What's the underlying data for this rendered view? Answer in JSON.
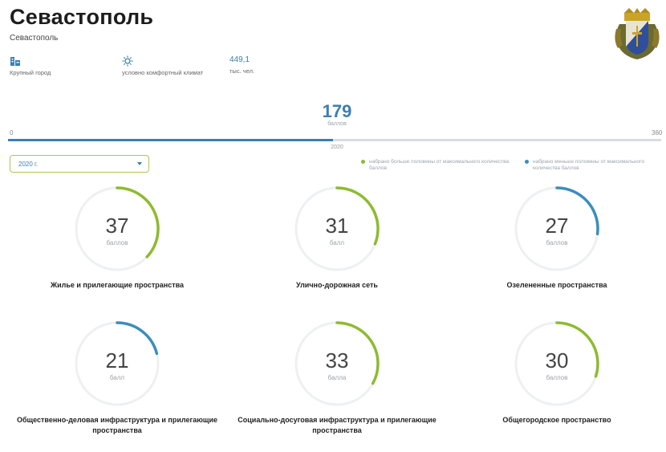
{
  "header": {
    "title": "Севастополь",
    "subtitle": "Севастополь"
  },
  "info": [
    {
      "icon": "city-buildings-icon",
      "label": "Крупный город"
    },
    {
      "icon": "sun-climate-icon",
      "label": "условно комфортный климат"
    },
    {
      "value": "449,1",
      "label": "тыс. чел."
    }
  ],
  "total": {
    "score": "179",
    "score_label": "баллов",
    "progress": {
      "value": 179,
      "min": 0,
      "max": 360
    },
    "tick_min": "0",
    "tick_max": "360",
    "tick_year": "2020"
  },
  "year_select": {
    "value": "2020 г."
  },
  "legend": [
    {
      "color": "#8dbb2f",
      "text": "набрано больше половины от максимального количества баллов"
    },
    {
      "color": "#3c8dbd",
      "text": "набрано меньше половины от максимального количества баллов"
    }
  ],
  "indices": [
    {
      "value": "37",
      "unit": "баллов",
      "name": "Жилье и прилегающие пространства",
      "fraction": 0.37,
      "color": "#8dbb2f"
    },
    {
      "value": "31",
      "unit": "балл",
      "name": "Улично-дорожная сеть",
      "fraction": 0.31,
      "color": "#8dbb2f"
    },
    {
      "value": "27",
      "unit": "баллов",
      "name": "Озелененные пространства",
      "fraction": 0.27,
      "color": "#3c8dbd"
    },
    {
      "value": "21",
      "unit": "балл",
      "name": "Общественно-деловая инфраструктура и прилегающие пространства",
      "fraction": 0.21,
      "color": "#3c8dbd"
    },
    {
      "value": "33",
      "unit": "балла",
      "name": "Социально-досуговая инфраструктура и прилегающие пространства",
      "fraction": 0.33,
      "color": "#8dbb2f"
    },
    {
      "value": "30",
      "unit": "баллов",
      "name": "Общегородское пространство",
      "fraction": 0.3,
      "color": "#8dbb2f"
    }
  ],
  "colors": {
    "accent_blue": "#3c7fb0",
    "accent_green": "#8dbb2f",
    "track": "#eef0f2"
  }
}
